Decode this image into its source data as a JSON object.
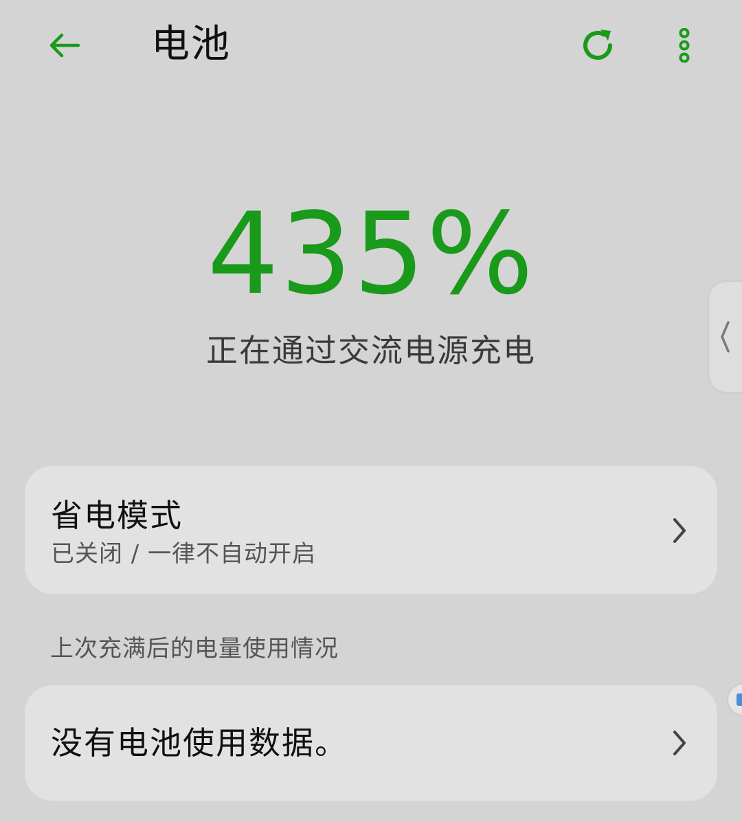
{
  "header": {
    "title": "电池",
    "back_icon": "arrow-left-icon",
    "refresh_icon": "refresh-icon",
    "more_icon": "more-vertical-icon"
  },
  "battery": {
    "level_text": "435%",
    "status_text": "正在通过交流电源充电"
  },
  "power_saving": {
    "title": "省电模式",
    "subtitle": "已关闭 / 一律不自动开启"
  },
  "usage_section": {
    "label": "上次充满后的电量使用情况",
    "empty_text": "没有电池使用数据。"
  },
  "colors": {
    "accent": "#1a9a1a",
    "background": "#d4d4d4",
    "card": "#e2e2e2"
  }
}
